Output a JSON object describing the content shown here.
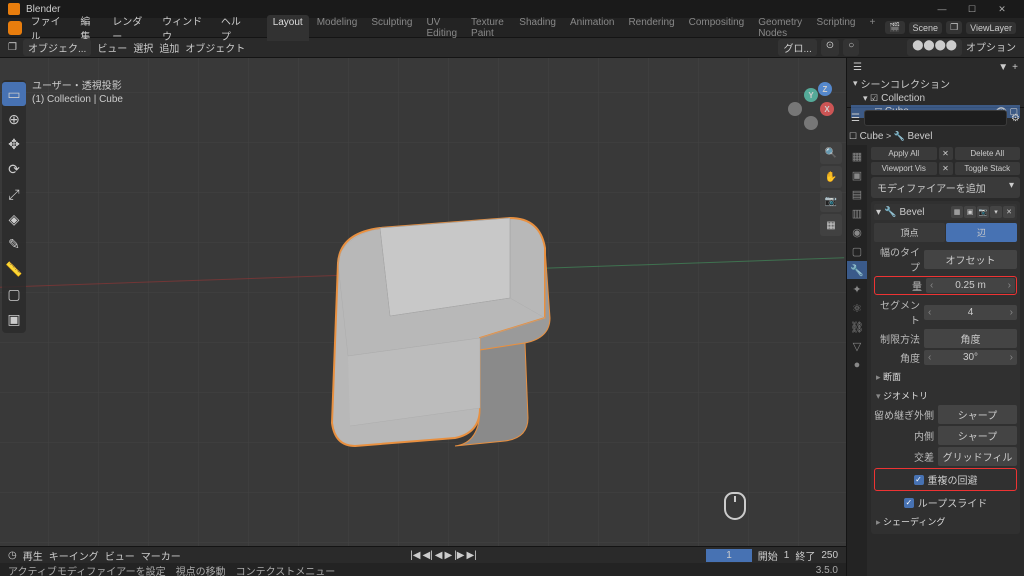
{
  "titlebar": {
    "app": "Blender"
  },
  "menubar": {
    "items": [
      "ファイル",
      "編集",
      "レンダー",
      "ウィンドウ",
      "ヘルプ"
    ]
  },
  "tabs": [
    "Layout",
    "Modeling",
    "Sculpting",
    "UV Editing",
    "Texture Paint",
    "Shading",
    "Animation",
    "Rendering",
    "Compositing",
    "Geometry Nodes",
    "Scripting"
  ],
  "active_tab": 0,
  "scene": {
    "label": "Scene",
    "viewlayer": "ViewLayer"
  },
  "toolbar2": {
    "mode": "オブジェク...",
    "view": "ビュー",
    "select": "選択",
    "add": "追加",
    "object": "オブジェクト",
    "global": "グロ...",
    "options": "オプション"
  },
  "vp_hdr": {
    "editor": "❐"
  },
  "corner": {
    "l1": "ユーザー・透視投影",
    "l2": "(1) Collection | Cube"
  },
  "outliner": {
    "title": "シーンコレクション",
    "collection": "Collection",
    "cube": "Cube"
  },
  "search_placeholder": "",
  "crumb": {
    "obj": "Cube",
    "mod": "Bevel"
  },
  "apply": {
    "a": "Apply All",
    "b": "Delete All",
    "c": "Viewport Vis",
    "d": "Toggle Stack"
  },
  "add_mod": "モディファイアーを追加",
  "bevel": {
    "name": "Bevel",
    "vertex": "頂点",
    "edge": "辺",
    "width_type_l": "幅のタイプ",
    "width_type_v": "オフセット",
    "width_l": "量",
    "width_v": "0.25 m",
    "seg_l": "セグメント",
    "seg_v": "4",
    "limit_l": "制限方法",
    "limit_v": "角度",
    "angle_l": "角度",
    "angle_v": "30°",
    "profile": "断面",
    "geometry": "ジオメトリ",
    "miter_out_l": "留め継ぎ外側",
    "miter_out_v": "シャープ",
    "miter_in_l": "内側",
    "miter_in_v": "シャープ",
    "intersect_l": "交差",
    "intersect_v": "グリッドフィル",
    "clamp": "重複の回避",
    "loopslide": "ループスライド",
    "shading": "シェーディング"
  },
  "timeline": {
    "playback": "再生",
    "keying": "キーイング",
    "view": "ビュー",
    "marker": "マーカー",
    "frame": "1",
    "start_l": "開始",
    "start_v": "1",
    "end_l": "終了",
    "end_v": "250",
    "status_a": "アクティブモディファイアーを設定",
    "status_b": "視点の移動",
    "status_c": "コンテクストメニュー",
    "version": "3.5.0"
  }
}
